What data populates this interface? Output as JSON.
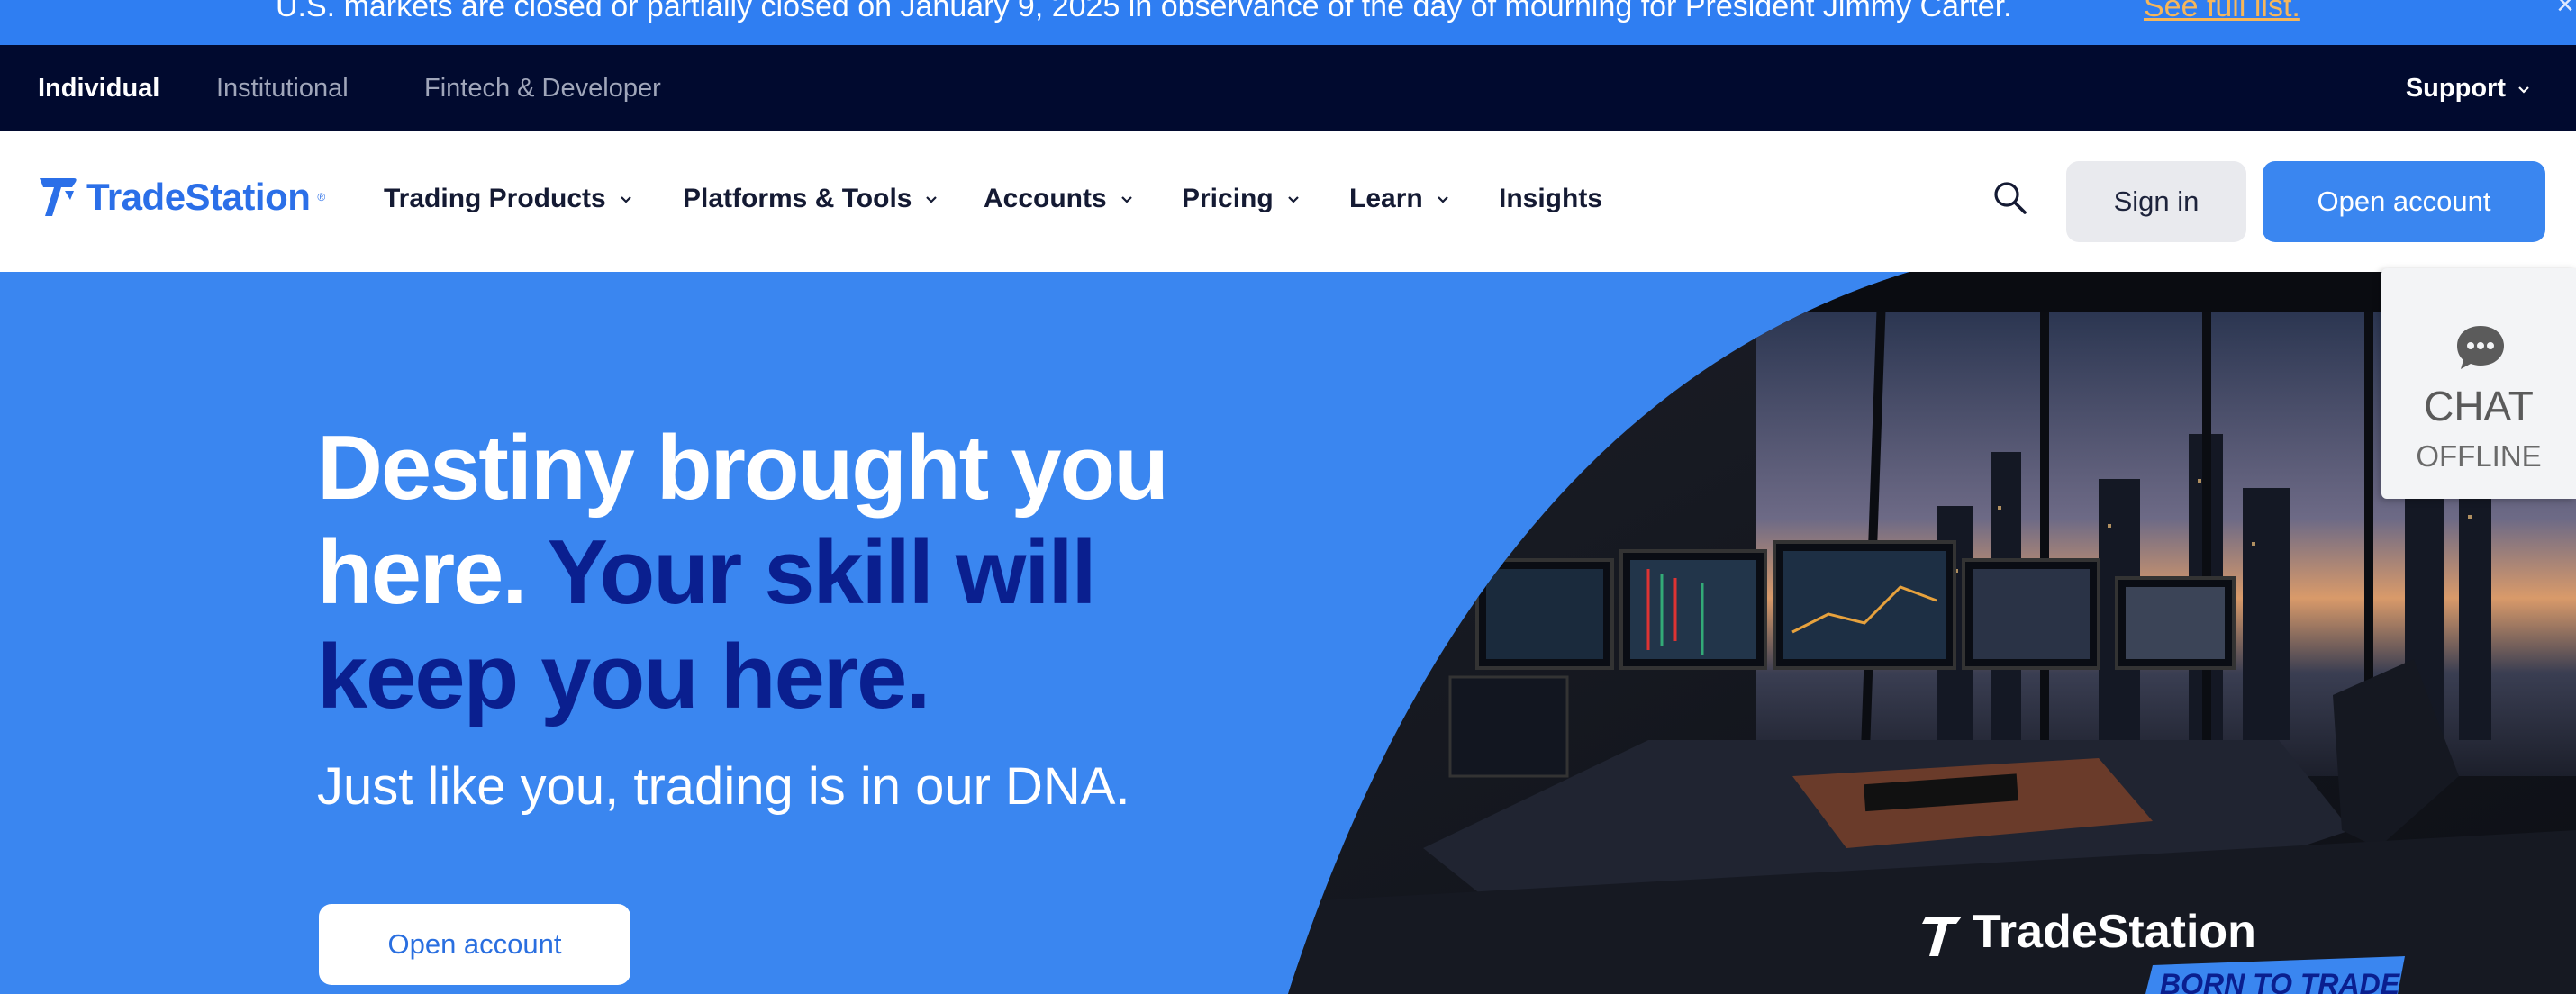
{
  "announcement": {
    "text": "U.S. markets are closed or partially closed on January 9, 2025 in observance of the day of mourning for President Jimmy Carter.",
    "link": "See full list.",
    "close": "×"
  },
  "segments": {
    "items": [
      "Individual",
      "Institutional",
      "Fintech & Developer"
    ],
    "support": "Support"
  },
  "nav": {
    "logo": "TradeStation",
    "items": [
      "Trading Products",
      "Platforms & Tools",
      "Accounts",
      "Pricing",
      "Learn",
      "Insights"
    ],
    "sign_in": "Sign in",
    "open_account": "Open account"
  },
  "hero": {
    "headline_white": "Destiny brought you here.",
    "headline_dark": "Your skill will keep you here.",
    "subline": "Just like you, trading is in our DNA.",
    "cta": "Open account",
    "image_logo": "TradeStation",
    "image_tagline": "BORN TO TRADE"
  },
  "chat": {
    "title": "CHAT",
    "status": "OFFLINE"
  },
  "colors": {
    "brand_blue": "#3a86f0",
    "navy": "#010a2f",
    "headline_dark": "#0a1f8f",
    "link_orange": "#f6b65a"
  }
}
